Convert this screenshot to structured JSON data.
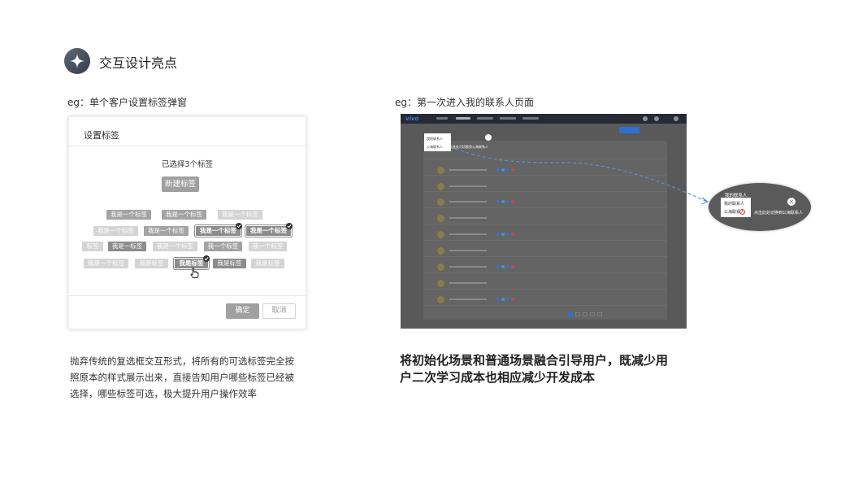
{
  "header": {
    "title": "交互设计亮点",
    "icon": "sparkle-icon"
  },
  "left": {
    "caption": "eg：单个客户设置标签弹窗",
    "dialog": {
      "title": "设置标签",
      "selected_text": "已选择3个标签",
      "new_tag_label": "新建标签",
      "tags": [
        "我是一个标签",
        "我是一个标签",
        "我是一个标签",
        "我是一个标签",
        "我是一个标签",
        "我是一个标签",
        "我是一个标签",
        "标签",
        "我是一标签",
        "我是一个标签",
        "我一个标签",
        "我一个标签",
        "我是一个标签",
        "我是标签",
        "我是标签",
        "我是标签",
        "我是标签"
      ],
      "confirm_label": "确定",
      "cancel_label": "取消"
    },
    "description": [
      "抛弃传统的复选框交互形式，将所有的可选标签完全按",
      "照原本的样式展示出来，直接告知用户哪些标签已经被",
      "选择，哪些标签可选，极大提升用户操作效率"
    ]
  },
  "right": {
    "caption": "eg：第一次进入我的联系人页面",
    "screenshot": {
      "logo": "vivo",
      "popup_items": [
        "我的联系人",
        "公海联系人"
      ],
      "tip": "点击此处可切换到公海联系人"
    },
    "zoom": {
      "header": "我的联系人",
      "items": [
        "我的联系人",
        "公海联系人"
      ],
      "tip": "点击此处切换到公海联系人",
      "close_glyph": "×"
    },
    "description": [
      "将初始化场景和普通场景融合引导用户，既减少用",
      "户二次学习成本也相应减少开发成本"
    ]
  },
  "colors": {
    "accent_blue": "#2f6fd0",
    "highlight_red": "#e23838",
    "dark_icon": "#3f4854"
  }
}
